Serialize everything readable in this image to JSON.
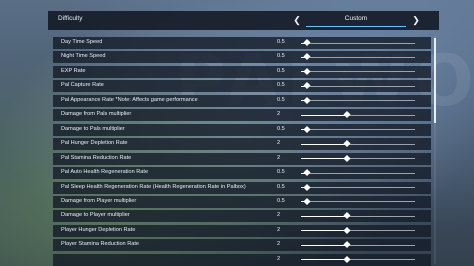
{
  "header": {
    "label": "Difficulty",
    "value": "Custom",
    "prev_icon": "chevron-left-icon",
    "next_icon": "chevron-right-icon"
  },
  "settings": [
    {
      "label": "Day Time Speed",
      "value": "0.5",
      "fraction": 0.05
    },
    {
      "label": "Night Time Speed",
      "value": "0.5",
      "fraction": 0.05
    },
    {
      "label": "EXP Rate",
      "value": "0.5",
      "fraction": 0.05
    },
    {
      "label": "Pal Capture Rate",
      "value": "0.5",
      "fraction": 0.05
    },
    {
      "label": "Pal Appearance Rate *Note: Affects game performance",
      "value": "0.5",
      "fraction": 0.05
    },
    {
      "label": "Damage from Pals multiplier",
      "value": "2",
      "fraction": 0.4
    },
    {
      "label": "Damage to Pals multiplier",
      "value": "0.5",
      "fraction": 0.05
    },
    {
      "label": "Pal Hunger Depletion Rate",
      "value": "2",
      "fraction": 0.4
    },
    {
      "label": "Pal Stamina Reduction Rate",
      "value": "2",
      "fraction": 0.4
    },
    {
      "label": "Pal Auto Health Regeneration Rate",
      "value": "0.5",
      "fraction": 0.05
    },
    {
      "label": "Pal Sleep Health Regeneration Rate (Health Regeneration Rate in Palbox)",
      "value": "0.5",
      "fraction": 0.05
    },
    {
      "label": "Damage from Player multiplier",
      "value": "0.5",
      "fraction": 0.05
    },
    {
      "label": "Damage to Player multiplier",
      "value": "2",
      "fraction": 0.4
    },
    {
      "label": "Player Hunger Depletion Rate",
      "value": "2",
      "fraction": 0.4
    },
    {
      "label": "Player Stamina Reduction Rate",
      "value": "2",
      "fraction": 0.4
    },
    {
      "label": "",
      "value": "2",
      "fraction": 0.4
    }
  ],
  "colors": {
    "accent": "#6ec3ff",
    "row_bg": "#141b28"
  }
}
